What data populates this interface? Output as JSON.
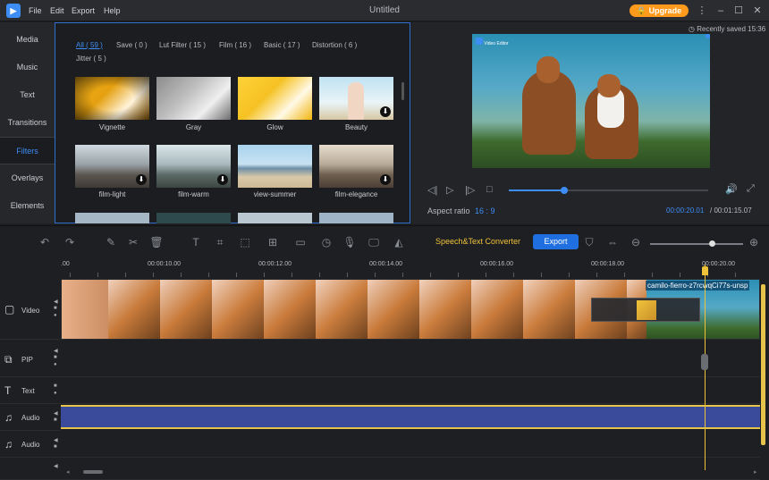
{
  "titlebar": {
    "menu": [
      "File",
      "Edit",
      "Export",
      "Help"
    ],
    "title": "Untitled",
    "upgrade_label": "Upgrade"
  },
  "sidebar": {
    "items": [
      {
        "label": "Media"
      },
      {
        "label": "Music"
      },
      {
        "label": "Text"
      },
      {
        "label": "Transitions"
      },
      {
        "label": "Filters"
      },
      {
        "label": "Overlays"
      },
      {
        "label": "Elements"
      }
    ],
    "active_index": 4
  },
  "filters": {
    "categories": [
      "All ( 59 )",
      "Save ( 0 )",
      "Lut Filter ( 15 )",
      "Film ( 16 )",
      "Basic ( 17 )",
      "Distortion ( 6 )",
      "Jitter ( 5 )"
    ],
    "items": [
      {
        "label": "Vignette",
        "downloadable": false
      },
      {
        "label": "Gray",
        "downloadable": false
      },
      {
        "label": "Glow",
        "downloadable": false
      },
      {
        "label": "Beauty",
        "downloadable": true
      },
      {
        "label": "film-light",
        "downloadable": true
      },
      {
        "label": "film-warm",
        "downloadable": true
      },
      {
        "label": "view-summer",
        "downloadable": false
      },
      {
        "label": "film-elegance",
        "downloadable": true
      }
    ]
  },
  "preview": {
    "saved_text": "Recently saved 15:36",
    "watermark": "Video Editor",
    "aspect_label": "Aspect ratio",
    "aspect_value": "16 : 9",
    "time_current": "00:00:20.01",
    "time_total": "/ 00:01:15.07"
  },
  "toolbar": {
    "speech_label": "Speech&Text Converter",
    "export_label": "Export"
  },
  "timeline": {
    "ruler_labels": [
      ".00",
      "00:00:10.00",
      "00:00:12.00",
      "00:00:14.00",
      "00:00:16.00",
      "00:00:18.00",
      "00:00:20.00"
    ],
    "tracks": [
      {
        "label": "Video",
        "icon": "video-track-icon"
      },
      {
        "label": "PIP",
        "icon": "pip-track-icon"
      },
      {
        "label": "Text",
        "icon": "text-track-icon"
      },
      {
        "label": "Audio",
        "icon": "audio-track-icon"
      },
      {
        "label": "Audio",
        "icon": "audio-track-icon"
      }
    ],
    "clip_label": "camilo-fierro-z7rcwqCi77s-unsp"
  },
  "colors": {
    "accent": "#3d8df5",
    "upgrade": "#ff9a1c",
    "speech": "#f0c23a",
    "audio_clip": "#3b4b9c",
    "playhead": "#f0c23a"
  }
}
